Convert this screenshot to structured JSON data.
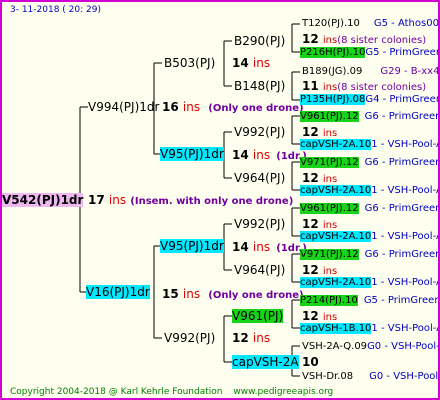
{
  "header": {
    "date": "3- 11-2018 ( 20: 29)"
  },
  "footer": {
    "copyright": "Copyright 2004-2018 @ Karl Kehrle Foundation",
    "url": "www.pedigreeapis.org"
  },
  "root": {
    "id": "V542(PJ)1dr",
    "ins": "17",
    "unit": "ins",
    "note": "(Insem. with only one drone)"
  },
  "gen1": {
    "sire": {
      "id": "V994(PJ)1dr",
      "ins": "16",
      "unit": "ins",
      "note": "(Only one drone)"
    },
    "dam": {
      "id": "V16(PJ)1dr",
      "ins": "15",
      "unit": "ins",
      "note": "(Only one drone)"
    }
  },
  "gen2": {
    "b503": {
      "id": "B503(PJ)",
      "ins": "14",
      "unit": "ins"
    },
    "v95a": {
      "id": "V95(PJ)1dr",
      "ins": "14",
      "unit": "ins",
      "note": "(1dr.)"
    },
    "v95b": {
      "id": "V95(PJ)1dr",
      "ins": "14",
      "unit": "ins",
      "note": "(1dr.)"
    },
    "v992": {
      "id": "V992(PJ)",
      "ins": "12",
      "unit": "ins"
    }
  },
  "gen3": {
    "b290": {
      "id": "B290(PJ)"
    },
    "b148": {
      "id": "B148(PJ)"
    },
    "v992a": {
      "id": "V992(PJ)",
      "ins": "12",
      "unit": "ins"
    },
    "v964a": {
      "id": "V964(PJ)",
      "ins": "12",
      "unit": "ins"
    },
    "v992b": {
      "id": "V992(PJ)",
      "ins": "12",
      "unit": "ins"
    },
    "v964b": {
      "id": "V964(PJ)",
      "ins": "12",
      "unit": "ins"
    },
    "v961": {
      "id": "V961(PJ)",
      "ins": "12",
      "unit": "ins"
    },
    "capvsh": {
      "id": "capVSH-2A",
      "ins": "10"
    }
  },
  "gen4": [
    {
      "label": "T120(PJ).10",
      "info": "G5 - Athos00R"
    },
    {
      "ins": "12",
      "unit": "ins",
      "note": "(8 sister colonies)"
    },
    {
      "label": "P216H(PJ).10",
      "info": "G5 - PrimGreen00"
    },
    {
      "label": "B189(JG).09",
      "info": "G29 - B-xx43"
    },
    {
      "ins": "11",
      "unit": "ins",
      "note": "(8 sister colonies)"
    },
    {
      "label": "P135H(PJ).08",
      "info": "G4 - PrimGreen00"
    },
    {
      "label": "V961(PJ).12",
      "info": "G6 - PrimGreen00"
    },
    {
      "label": "capVSH-2A.10",
      "info": "1 - VSH-Pool-AR"
    },
    {
      "label": "V971(PJ).12",
      "info": "G6 - PrimGreen00"
    },
    {
      "label": "capVSH-2A.10",
      "info": "1 - VSH-Pool-AR"
    },
    {
      "label": "V961(PJ).12",
      "info": "G6 - PrimGreen00"
    },
    {
      "label": "capVSH-2A.10",
      "info": "1 - VSH-Pool-AR"
    },
    {
      "label": "V971(PJ).12",
      "info": "G6 - PrimGreen00"
    },
    {
      "label": "capVSH-2A.10",
      "info": "1 - VSH-Pool-AR"
    },
    {
      "label": "P214(PJ).10",
      "info": "G5 - PrimGreen00"
    },
    {
      "label": "capVSH-1B.10",
      "info": "1 - VSH-Pool-AR"
    },
    {
      "label": "VSH-2A-Q.09",
      "info": "G0 - VSH-Pool-AR"
    },
    {
      "label": "VSH-Dr.08",
      "info": "G0 - VSH-Pool-AR"
    }
  ]
}
